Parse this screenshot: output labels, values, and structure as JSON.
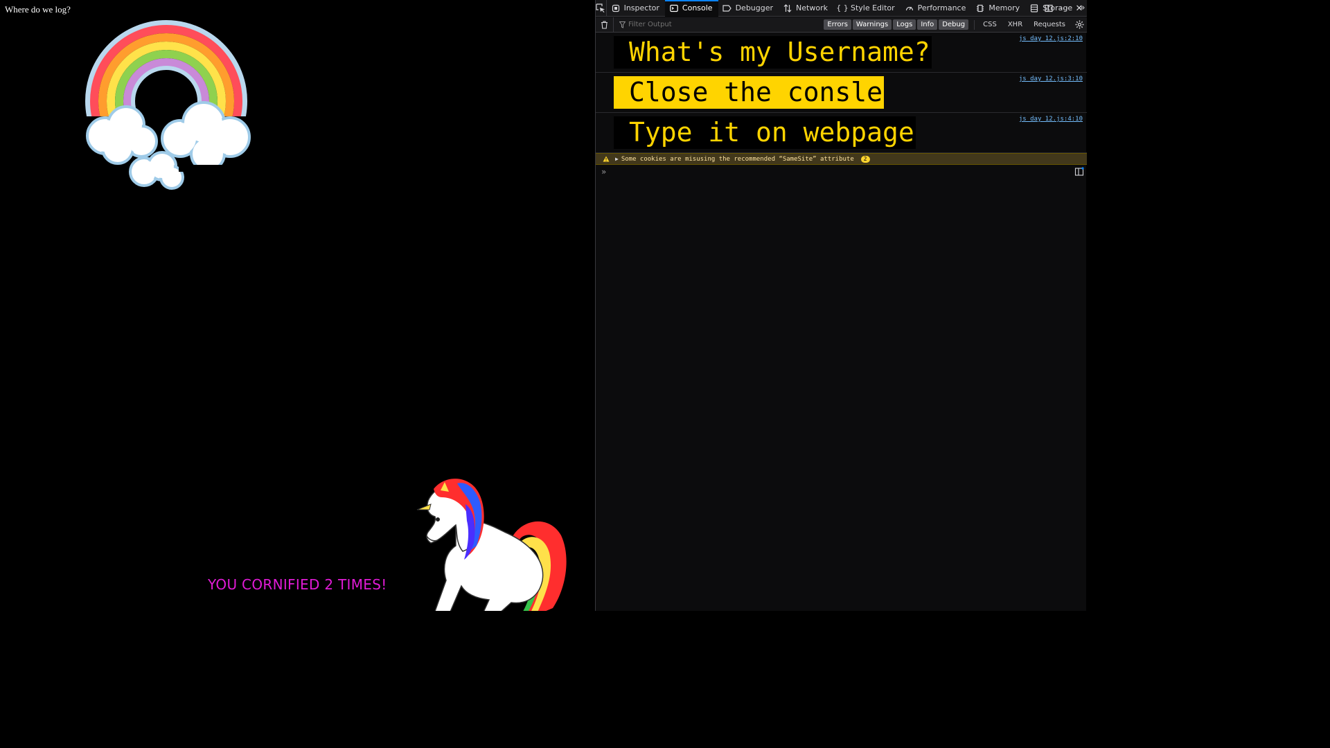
{
  "page": {
    "heading": "Where do we log?",
    "counter_text": "YOU CORNIFIED 2 TIMES!",
    "counter_color": "#e11bd6",
    "images": [
      "rainbow-with-clouds",
      "rainbow-unicorn"
    ]
  },
  "devtools": {
    "tabs": [
      {
        "label": "Inspector",
        "icon": "inspector-icon"
      },
      {
        "label": "Console",
        "icon": "console-icon",
        "selected": true
      },
      {
        "label": "Debugger",
        "icon": "debugger-icon"
      },
      {
        "label": "Network",
        "icon": "network-icon"
      },
      {
        "label": "Style Editor",
        "icon": "style-editor-icon"
      },
      {
        "label": "Performance",
        "icon": "performance-icon"
      },
      {
        "label": "Memory",
        "icon": "memory-icon"
      },
      {
        "label": "Storage",
        "icon": "storage-icon"
      }
    ],
    "filter_placeholder": "Filter Output",
    "levels": [
      "Errors",
      "Warnings",
      "Logs",
      "Info",
      "Debug"
    ],
    "net_filters": [
      "CSS",
      "XHR",
      "Requests"
    ],
    "messages": [
      {
        "text": "What's my Username?",
        "source": "js_day_12.js:2:10",
        "color": "#ffd400",
        "background": "#000000"
      },
      {
        "text": "Close the consle",
        "source": "js_day_12.js:3:10",
        "color": "#000000",
        "background": "#ffd400"
      },
      {
        "text": "Type it on webpage",
        "source": "js_day_12.js:4:10",
        "color": "#ffd400",
        "background": "#000000"
      }
    ],
    "warning": {
      "text": "Some cookies are misusing the recommended “SameSite” attribute",
      "count": "2"
    },
    "prompt": "»"
  }
}
